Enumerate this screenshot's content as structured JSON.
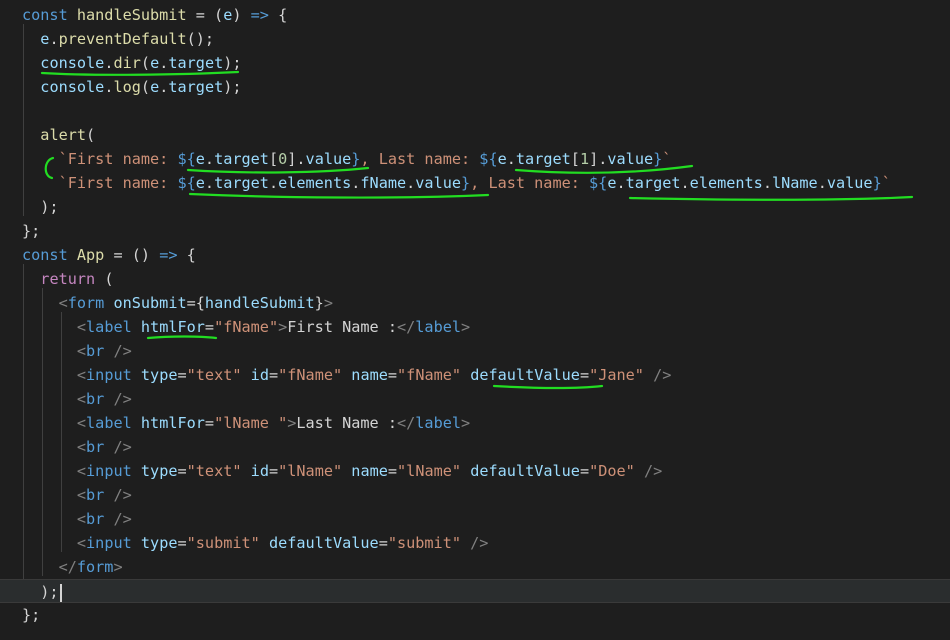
{
  "annotation_color": "#22dd22",
  "lines": [
    [
      [
        "k",
        "const "
      ],
      [
        "f",
        "handleSubmit"
      ],
      [
        "p",
        " = ("
      ],
      [
        "v",
        "e"
      ],
      [
        "p",
        ") "
      ],
      [
        "k",
        "=>"
      ],
      [
        "p",
        " {"
      ]
    ],
    [
      [
        "p",
        "  "
      ],
      [
        "v",
        "e"
      ],
      [
        "p",
        "."
      ],
      [
        "f",
        "preventDefault"
      ],
      [
        "p",
        "();"
      ]
    ],
    [
      [
        "p",
        "  "
      ],
      [
        "v",
        "console"
      ],
      [
        "p",
        "."
      ],
      [
        "f",
        "dir"
      ],
      [
        "p",
        "("
      ],
      [
        "v",
        "e"
      ],
      [
        "p",
        "."
      ],
      [
        "v",
        "target"
      ],
      [
        "p",
        ");"
      ]
    ],
    [
      [
        "p",
        "  "
      ],
      [
        "v",
        "console"
      ],
      [
        "p",
        "."
      ],
      [
        "f",
        "log"
      ],
      [
        "p",
        "("
      ],
      [
        "v",
        "e"
      ],
      [
        "p",
        "."
      ],
      [
        "v",
        "target"
      ],
      [
        "p",
        ");"
      ]
    ],
    [
      [
        "p",
        ""
      ]
    ],
    [
      [
        "p",
        "  "
      ],
      [
        "f",
        "alert"
      ],
      [
        "p",
        "("
      ]
    ],
    [
      [
        "p",
        "    "
      ],
      [
        "s",
        "`First name: "
      ],
      [
        "k",
        "${"
      ],
      [
        "v",
        "e"
      ],
      [
        "p",
        "."
      ],
      [
        "v",
        "target"
      ],
      [
        "p",
        "["
      ],
      [
        "n",
        "0"
      ],
      [
        "p",
        "]."
      ],
      [
        "v",
        "value"
      ],
      [
        "k",
        "}"
      ],
      [
        "s",
        ", Last name: "
      ],
      [
        "k",
        "${"
      ],
      [
        "v",
        "e"
      ],
      [
        "p",
        "."
      ],
      [
        "v",
        "target"
      ],
      [
        "p",
        "["
      ],
      [
        "n",
        "1"
      ],
      [
        "p",
        "]."
      ],
      [
        "v",
        "value"
      ],
      [
        "k",
        "}"
      ],
      [
        "s",
        "`"
      ]
    ],
    [
      [
        "p",
        "    "
      ],
      [
        "s",
        "`First name: "
      ],
      [
        "k",
        "${"
      ],
      [
        "v",
        "e"
      ],
      [
        "p",
        "."
      ],
      [
        "v",
        "target"
      ],
      [
        "p",
        "."
      ],
      [
        "v",
        "elements"
      ],
      [
        "p",
        "."
      ],
      [
        "v",
        "fName"
      ],
      [
        "p",
        "."
      ],
      [
        "v",
        "value"
      ],
      [
        "k",
        "}"
      ],
      [
        "s",
        ", Last name: "
      ],
      [
        "k",
        "${"
      ],
      [
        "v",
        "e"
      ],
      [
        "p",
        "."
      ],
      [
        "v",
        "target"
      ],
      [
        "p",
        "."
      ],
      [
        "v",
        "elements"
      ],
      [
        "p",
        "."
      ],
      [
        "v",
        "lName"
      ],
      [
        "p",
        "."
      ],
      [
        "v",
        "value"
      ],
      [
        "k",
        "}"
      ],
      [
        "s",
        "`"
      ]
    ],
    [
      [
        "p",
        "  );"
      ]
    ],
    [
      [
        "p",
        "};"
      ]
    ],
    [
      [
        "k",
        "const "
      ],
      [
        "f",
        "App"
      ],
      [
        "p",
        " = () "
      ],
      [
        "k",
        "=>"
      ],
      [
        "p",
        " {"
      ]
    ],
    [
      [
        "p",
        "  "
      ],
      [
        "c",
        "return"
      ],
      [
        "p",
        " ("
      ]
    ],
    [
      [
        "p",
        "    "
      ],
      [
        "t",
        "<"
      ],
      [
        "k",
        "form"
      ],
      [
        "p",
        " "
      ],
      [
        "a",
        "onSubmit"
      ],
      [
        "p",
        "={"
      ],
      [
        "v",
        "handleSubmit"
      ],
      [
        "p",
        "}"
      ],
      [
        "t",
        ">"
      ]
    ],
    [
      [
        "p",
        "      "
      ],
      [
        "t",
        "<"
      ],
      [
        "k",
        "label"
      ],
      [
        "p",
        " "
      ],
      [
        "a",
        "htmlFor"
      ],
      [
        "p",
        "="
      ],
      [
        "s",
        "\"fName\""
      ],
      [
        "t",
        ">"
      ],
      [
        "p",
        "First Name :"
      ],
      [
        "t",
        "</"
      ],
      [
        "k",
        "label"
      ],
      [
        "t",
        ">"
      ]
    ],
    [
      [
        "p",
        "      "
      ],
      [
        "t",
        "<"
      ],
      [
        "k",
        "br"
      ],
      [
        "p",
        " "
      ],
      [
        "t",
        "/>"
      ]
    ],
    [
      [
        "p",
        "      "
      ],
      [
        "t",
        "<"
      ],
      [
        "k",
        "input"
      ],
      [
        "p",
        " "
      ],
      [
        "a",
        "type"
      ],
      [
        "p",
        "="
      ],
      [
        "s",
        "\"text\""
      ],
      [
        "p",
        " "
      ],
      [
        "a",
        "id"
      ],
      [
        "p",
        "="
      ],
      [
        "s",
        "\"fName\""
      ],
      [
        "p",
        " "
      ],
      [
        "a",
        "name"
      ],
      [
        "p",
        "="
      ],
      [
        "s",
        "\"fName\""
      ],
      [
        "p",
        " "
      ],
      [
        "a",
        "defaultValue"
      ],
      [
        "p",
        "="
      ],
      [
        "s",
        "\"Jane\""
      ],
      [
        "p",
        " "
      ],
      [
        "t",
        "/>"
      ]
    ],
    [
      [
        "p",
        "      "
      ],
      [
        "t",
        "<"
      ],
      [
        "k",
        "br"
      ],
      [
        "p",
        " "
      ],
      [
        "t",
        "/>"
      ]
    ],
    [
      [
        "p",
        "      "
      ],
      [
        "t",
        "<"
      ],
      [
        "k",
        "label"
      ],
      [
        "p",
        " "
      ],
      [
        "a",
        "htmlFor"
      ],
      [
        "p",
        "="
      ],
      [
        "s",
        "\"lName \""
      ],
      [
        "t",
        ">"
      ],
      [
        "p",
        "Last Name :"
      ],
      [
        "t",
        "</"
      ],
      [
        "k",
        "label"
      ],
      [
        "t",
        ">"
      ]
    ],
    [
      [
        "p",
        "      "
      ],
      [
        "t",
        "<"
      ],
      [
        "k",
        "br"
      ],
      [
        "p",
        " "
      ],
      [
        "t",
        "/>"
      ]
    ],
    [
      [
        "p",
        "      "
      ],
      [
        "t",
        "<"
      ],
      [
        "k",
        "input"
      ],
      [
        "p",
        " "
      ],
      [
        "a",
        "type"
      ],
      [
        "p",
        "="
      ],
      [
        "s",
        "\"text\""
      ],
      [
        "p",
        " "
      ],
      [
        "a",
        "id"
      ],
      [
        "p",
        "="
      ],
      [
        "s",
        "\"lName\""
      ],
      [
        "p",
        " "
      ],
      [
        "a",
        "name"
      ],
      [
        "p",
        "="
      ],
      [
        "s",
        "\"lName\""
      ],
      [
        "p",
        " "
      ],
      [
        "a",
        "defaultValue"
      ],
      [
        "p",
        "="
      ],
      [
        "s",
        "\"Doe\""
      ],
      [
        "p",
        " "
      ],
      [
        "t",
        "/>"
      ]
    ],
    [
      [
        "p",
        "      "
      ],
      [
        "t",
        "<"
      ],
      [
        "k",
        "br"
      ],
      [
        "p",
        " "
      ],
      [
        "t",
        "/>"
      ]
    ],
    [
      [
        "p",
        "      "
      ],
      [
        "t",
        "<"
      ],
      [
        "k",
        "br"
      ],
      [
        "p",
        " "
      ],
      [
        "t",
        "/>"
      ]
    ],
    [
      [
        "p",
        "      "
      ],
      [
        "t",
        "<"
      ],
      [
        "k",
        "input"
      ],
      [
        "p",
        " "
      ],
      [
        "a",
        "type"
      ],
      [
        "p",
        "="
      ],
      [
        "s",
        "\"submit\""
      ],
      [
        "p",
        " "
      ],
      [
        "a",
        "defaultValue"
      ],
      [
        "p",
        "="
      ],
      [
        "s",
        "\"submit\""
      ],
      [
        "p",
        " "
      ],
      [
        "t",
        "/>"
      ]
    ],
    [
      [
        "p",
        "    "
      ],
      [
        "t",
        "</"
      ],
      [
        "k",
        "form"
      ],
      [
        "t",
        ">"
      ]
    ],
    [
      [
        "p",
        "  );"
      ]
    ],
    [
      [
        "p",
        "};"
      ]
    ]
  ]
}
